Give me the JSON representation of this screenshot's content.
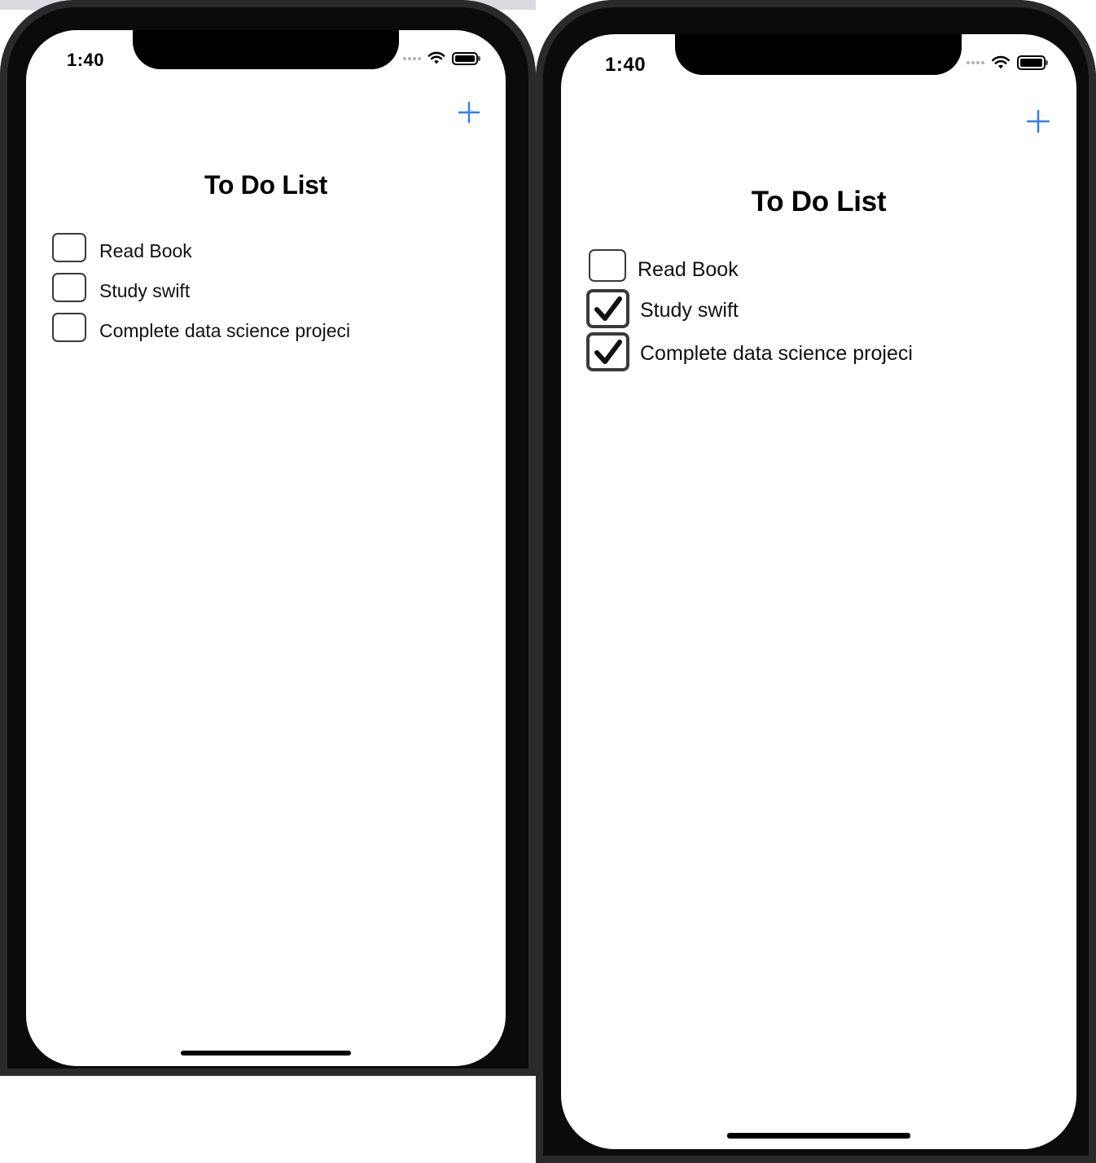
{
  "colors": {
    "accent": "#2f7cf6",
    "bezel": "#0b0b0b",
    "checkbox_border": "#3a3a3a"
  },
  "screens": [
    {
      "status": {
        "time": "1:40"
      },
      "nav": {
        "add_icon": "plus-icon"
      },
      "title": "To Do List",
      "items": [
        {
          "label": "Read Book",
          "checked": false
        },
        {
          "label": "Study swift",
          "checked": false
        },
        {
          "label": "Complete data science projeci",
          "checked": false
        }
      ]
    },
    {
      "status": {
        "time": "1:40"
      },
      "nav": {
        "add_icon": "plus-icon"
      },
      "title": "To Do List",
      "items": [
        {
          "label": "Read Book",
          "checked": false
        },
        {
          "label": "Study swift",
          "checked": true
        },
        {
          "label": "Complete data science projeci",
          "checked": true
        }
      ]
    }
  ]
}
